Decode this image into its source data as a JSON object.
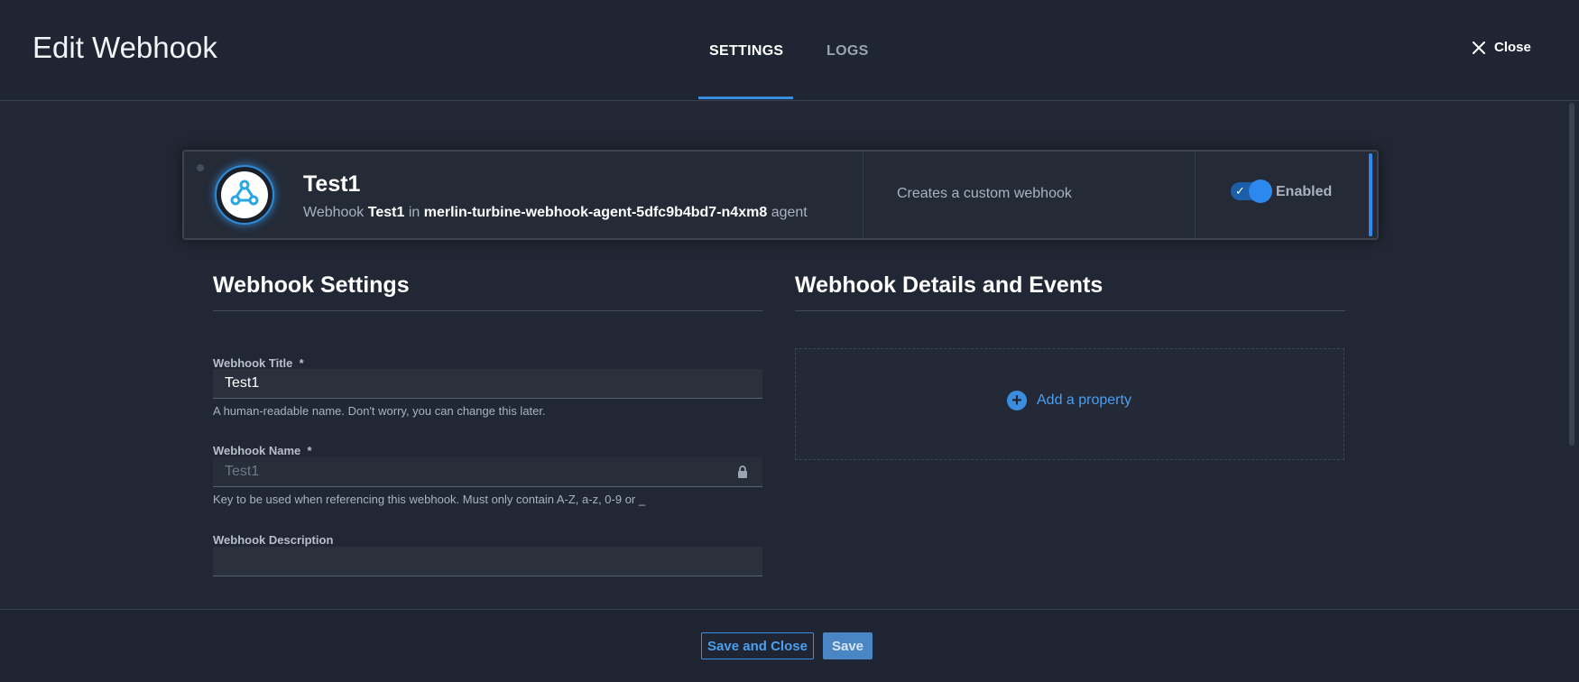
{
  "header": {
    "title": "Edit Webhook",
    "tabs": [
      {
        "label": "SETTINGS",
        "active": true
      },
      {
        "label": "LOGS",
        "active": false
      }
    ],
    "close_label": "Close"
  },
  "card": {
    "name": "Test1",
    "sub_prefix": "Webhook",
    "sub_name": "Test1",
    "sub_in": "in",
    "agent_id": "merlin-turbine-webhook-agent-5dfc9b4bd7-n4xm8",
    "sub_suffix": "agent",
    "description": "Creates a custom webhook",
    "status_label": "Enabled",
    "enabled": true,
    "avatar_icon": "webhook-icon",
    "accent_color": "#2d88ee"
  },
  "settings": {
    "section_title": "Webhook Settings",
    "title_field": {
      "label": "Webhook Title",
      "required_mark": "*",
      "value": "Test1",
      "help": "A human-readable name. Don't worry, you can change this later."
    },
    "name_field": {
      "label": "Webhook Name",
      "required_mark": "*",
      "value": "Test1",
      "help": "Key to be used when referencing this webhook. Must only contain A-Z, a-z, 0-9 or _",
      "icon": "lock-icon"
    },
    "description_field": {
      "label": "Webhook Description",
      "value": ""
    }
  },
  "details": {
    "section_title": "Webhook Details and Events",
    "add_property_label": "Add a property",
    "add_icon": "plus-circle-icon"
  },
  "footer": {
    "save_and_close_label": "Save and Close",
    "save_label": "Save"
  }
}
